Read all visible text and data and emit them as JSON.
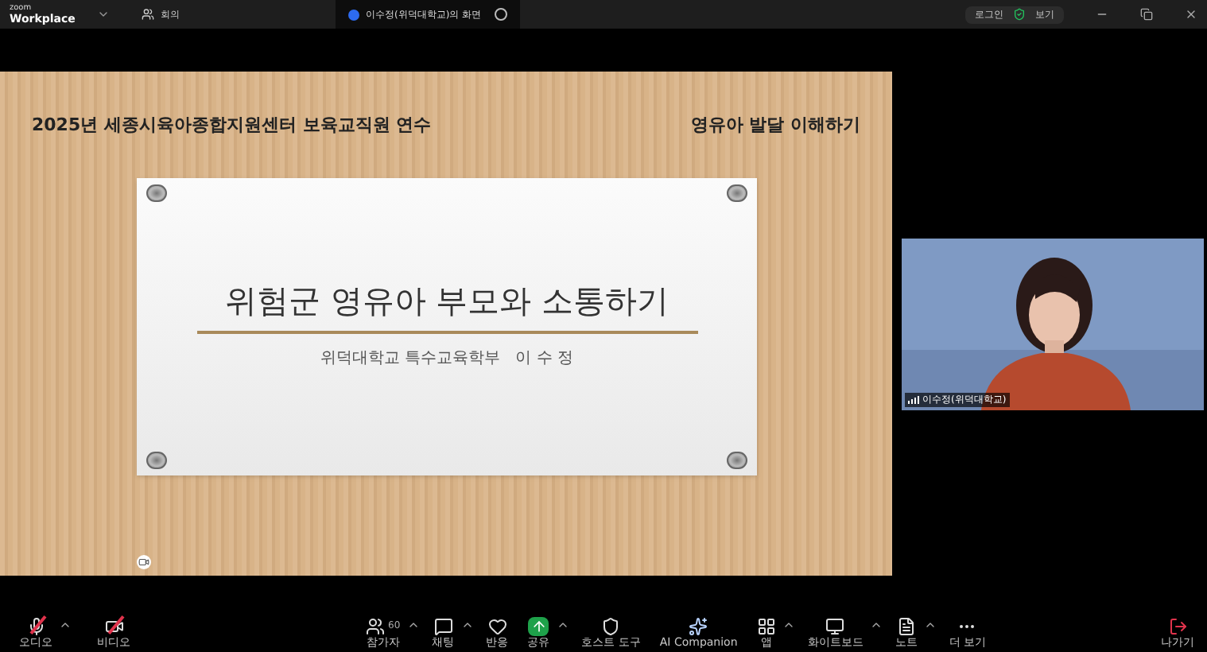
{
  "app": {
    "logo_top": "zoom",
    "logo_bottom": "Workplace"
  },
  "top_tabs": [
    {
      "label": "회의",
      "selected": false
    },
    {
      "label": "이수정(위덕대학교)의 화면",
      "selected": true
    }
  ],
  "top_actions": {
    "login": "로그인",
    "view": "보기"
  },
  "slide": {
    "header_left": "2025년 세종시육아종합지원센터 보육교직원 연수",
    "header_right": "영유아 발달 이해하기",
    "title": "위험군 영유아 부모와 소통하기",
    "subtitle": "위덕대학교 특수교육학부   이 수 정"
  },
  "video": {
    "name": "이수정(위덕대학교)"
  },
  "toolbar_left": [
    {
      "kind": "audio",
      "label": "오디오",
      "muted": true,
      "menu": true
    },
    {
      "kind": "video",
      "label": "비디오",
      "muted": true,
      "menu": false
    }
  ],
  "toolbar_center": [
    {
      "kind": "participants",
      "label": "참가자",
      "count": "60",
      "menu": true
    },
    {
      "kind": "chat",
      "label": "채팅",
      "menu": true
    },
    {
      "kind": "react",
      "label": "반응",
      "menu": false
    },
    {
      "kind": "share",
      "label": "공유",
      "menu": true
    },
    {
      "kind": "host",
      "label": "호스트 도구",
      "menu": false
    },
    {
      "kind": "ai",
      "label": "AI Companion",
      "menu": false
    },
    {
      "kind": "apps",
      "label": "앱",
      "menu": true
    },
    {
      "kind": "whiteboard",
      "label": "화이트보드",
      "menu": true
    },
    {
      "kind": "notes",
      "label": "노트",
      "menu": true
    },
    {
      "kind": "more",
      "label": "더 보기",
      "menu": false
    }
  ],
  "leave": {
    "label": "나가기"
  }
}
